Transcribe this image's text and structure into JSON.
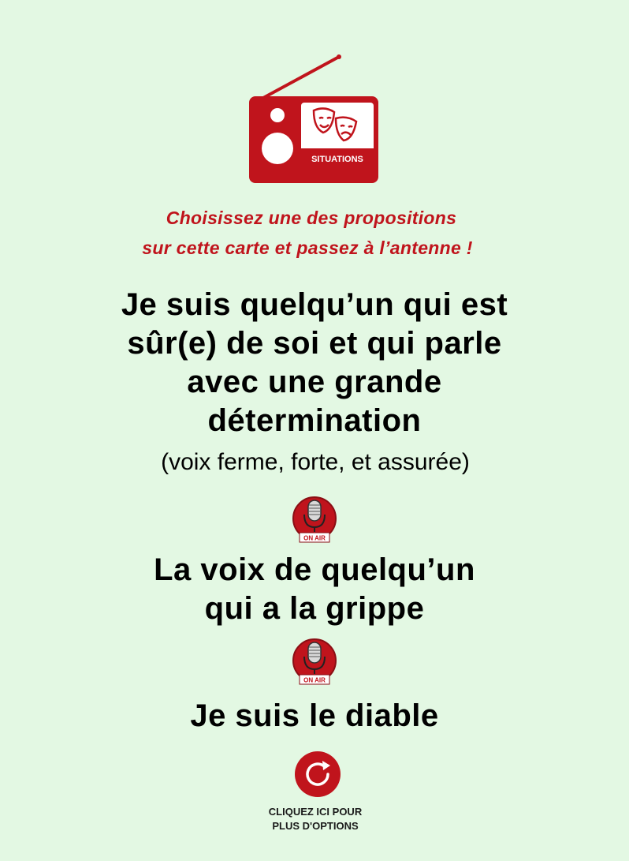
{
  "radio": {
    "label": "SITUATIONS",
    "icon": "radio-theater-masks-icon",
    "color": "#c0141c"
  },
  "instruction": {
    "line1": "Choisissez une des propositions",
    "line2": "sur cette carte et passez à l’antenne !"
  },
  "proposals": [
    {
      "lines": [
        "Je suis quelqu’un qui est",
        "sûr(e) de soi et qui parle",
        "avec une grande",
        "détermination"
      ],
      "note": "(voix ferme, forte, et assurée)"
    },
    {
      "lines": [
        "La voix de quelqu’un",
        "qui a la grippe"
      ]
    },
    {
      "lines": [
        "Je suis le diable"
      ]
    }
  ],
  "onair": {
    "label": "ON AIR",
    "icon": "on-air-microphone-icon"
  },
  "more_options": {
    "icon": "refresh-icon",
    "line1": "CLIQUEZ ICI POUR",
    "line2": "PLUS D'OPTIONS"
  }
}
